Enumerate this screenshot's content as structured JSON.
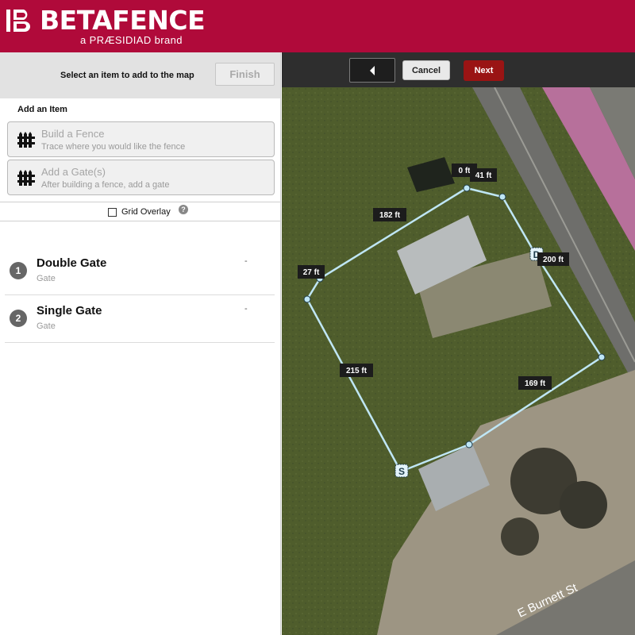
{
  "header": {
    "brand": "BETAFENCE",
    "tagline": "a PRÆSIDIAD brand",
    "brand_color": "#b00a3a"
  },
  "sidebar": {
    "prompt": "Select an item to add to the map",
    "finish_label": "Finish",
    "add_title": "Add an Item",
    "items": [
      {
        "title": "Build a Fence",
        "subtitle": "Trace where you would like the fence",
        "icon": "fence-icon"
      },
      {
        "title": "Add a Gate(s)",
        "subtitle": "After building a fence, add a gate",
        "icon": "fence-icon"
      }
    ],
    "grid_overlay_label": "Grid Overlay",
    "grid_overlay_checked": false,
    "help_symbol": "?",
    "gates": [
      {
        "number": "1",
        "name": "Double Gate",
        "type": "Gate",
        "value": "-"
      },
      {
        "number": "2",
        "name": "Single Gate",
        "type": "Gate",
        "value": "-"
      }
    ]
  },
  "toolbar": {
    "back_icon": "chevron-left-icon",
    "cancel_label": "Cancel",
    "next_label": "Next",
    "next_color": "#9a1414"
  },
  "map": {
    "segment_labels": [
      "0 ft",
      "41 ft",
      "182 ft",
      "27 ft",
      "200 ft",
      "215 ft",
      "169 ft"
    ],
    "gate_markers": [
      "D",
      "S"
    ],
    "street_label": "E Burnett St",
    "fence_color": "#bfe6f5"
  }
}
